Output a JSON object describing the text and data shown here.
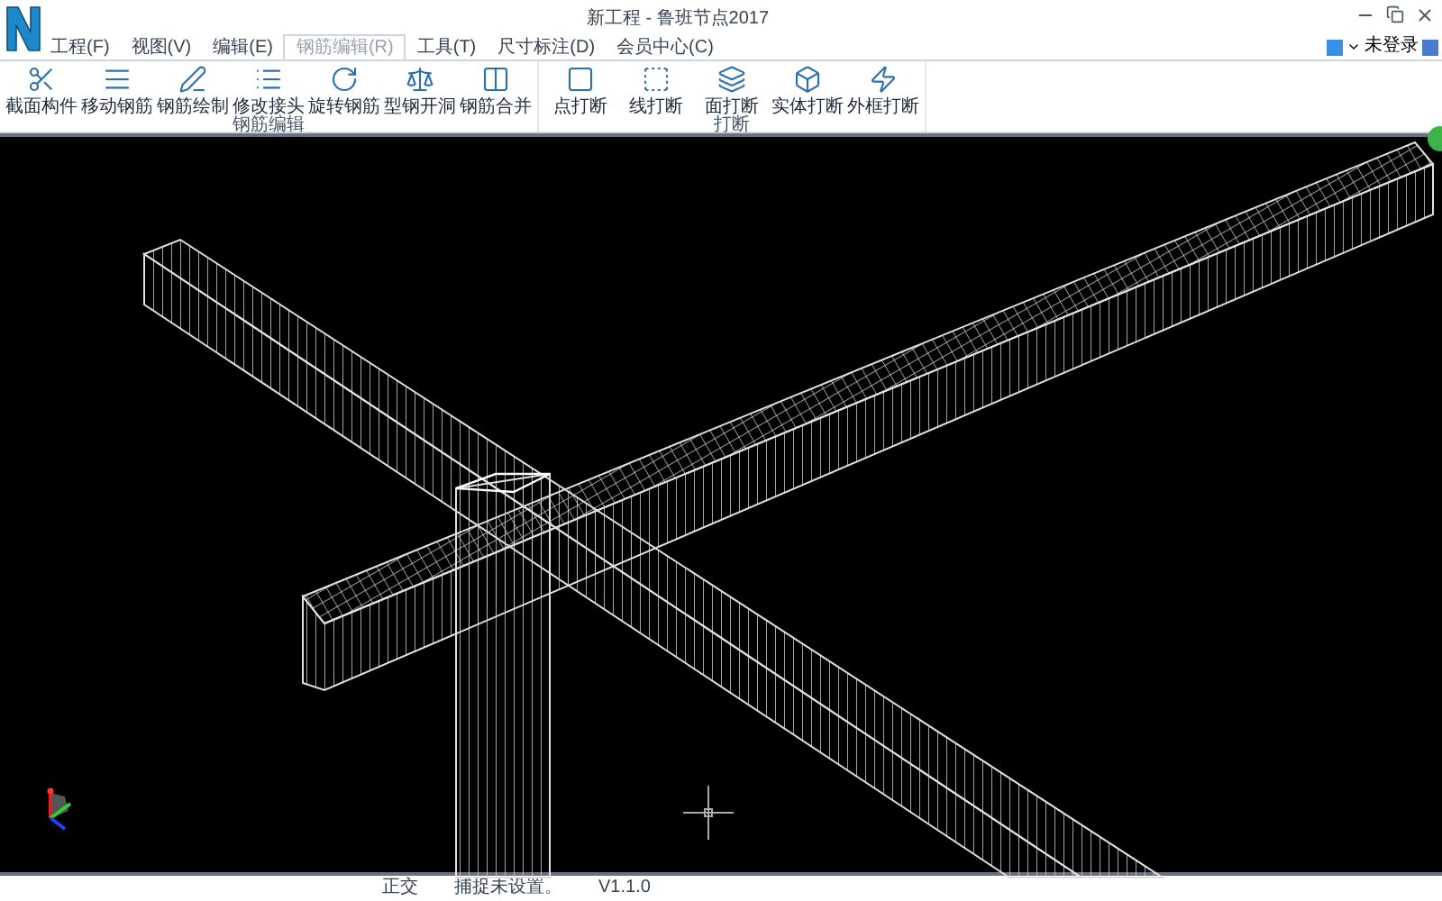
{
  "window": {
    "title": "新工程 - 鲁班节点2017"
  },
  "tabs": [
    {
      "label": "工程(F)",
      "selected": false
    },
    {
      "label": "视图(V)",
      "selected": false
    },
    {
      "label": "编辑(E)",
      "selected": false
    },
    {
      "label": "钢筋编辑(R)",
      "selected": true
    },
    {
      "label": "工具(T)",
      "selected": false
    },
    {
      "label": "尺寸标注(D)",
      "selected": false
    },
    {
      "label": "会员中心(C)",
      "selected": false
    }
  ],
  "account": {
    "label": "未登录"
  },
  "ribbon": {
    "groups": [
      {
        "label": "钢筋编辑",
        "buttons": [
          {
            "label": "截面构件"
          },
          {
            "label": "移动钢筋"
          },
          {
            "label": "钢筋绘制"
          },
          {
            "label": "修改接头"
          },
          {
            "label": "旋转钢筋"
          },
          {
            "label": "型钢开洞"
          },
          {
            "label": "钢筋合并"
          }
        ]
      },
      {
        "label": "打断",
        "buttons": [
          {
            "label": "点打断"
          },
          {
            "label": "线打断"
          },
          {
            "label": "面打断"
          },
          {
            "label": "实体打断"
          },
          {
            "label": "外框打断"
          }
        ]
      }
    ]
  },
  "status_bar": [
    "正交",
    "捕捉未设置。",
    "V1.1.0"
  ]
}
